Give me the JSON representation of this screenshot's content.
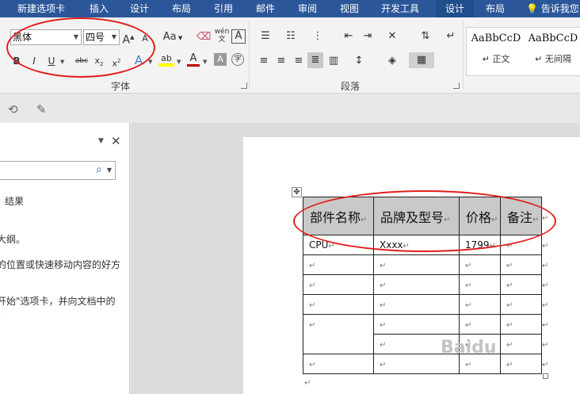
{
  "tabs": [
    {
      "label": "新建选项卡"
    },
    {
      "label": "插入"
    },
    {
      "label": "设计"
    },
    {
      "label": "布局"
    },
    {
      "label": "引用"
    },
    {
      "label": "邮件"
    },
    {
      "label": "审阅"
    },
    {
      "label": "视图"
    },
    {
      "label": "开发工具"
    },
    {
      "label": "设计"
    },
    {
      "label": "布局"
    }
  ],
  "tell_me": "告诉我您",
  "font": {
    "name": "黑体",
    "size": "四号",
    "group_label": "字体",
    "grow": "A",
    "shrink": "A",
    "case": "Aa",
    "bold": "B",
    "italic": "I",
    "underline": "U",
    "strike": "abc",
    "sub": "x",
    "effects": "A",
    "highlight": "ab",
    "color": "A",
    "shade": "A",
    "phonetic": "wén",
    "border": "A",
    "enclose": "字",
    "color_accent": "#c00000",
    "highlight_accent": "#ffff00"
  },
  "paragraph": {
    "group_label": "段落"
  },
  "styles": [
    {
      "sample": "AaBbCcD",
      "name": "↵ 正文"
    },
    {
      "sample": "AaBbCcD",
      "name": "↵ 无间隔"
    }
  ],
  "nav": {
    "tab_results": "结果",
    "lines": [
      "大纲。",
      "的位置或快速移动内容的好方",
      "开始\"选项卡，并向文档中的",
      "。"
    ]
  },
  "table": {
    "headers": [
      "部件名称",
      "品牌及型号",
      "价格",
      "备注"
    ],
    "rows": [
      [
        "CPU",
        "Xxxx",
        "1799",
        ""
      ],
      [
        "",
        "",
        "",
        ""
      ],
      [
        "",
        "",
        "",
        ""
      ],
      [
        "",
        "",
        "",
        ""
      ],
      [
        "",
        "",
        "",
        ""
      ],
      [
        "",
        "",
        "",
        ""
      ],
      [
        "",
        "",
        "",
        ""
      ]
    ],
    "para_mark": "↵",
    "cell_mark": "↵"
  },
  "watermark": "Baidu"
}
